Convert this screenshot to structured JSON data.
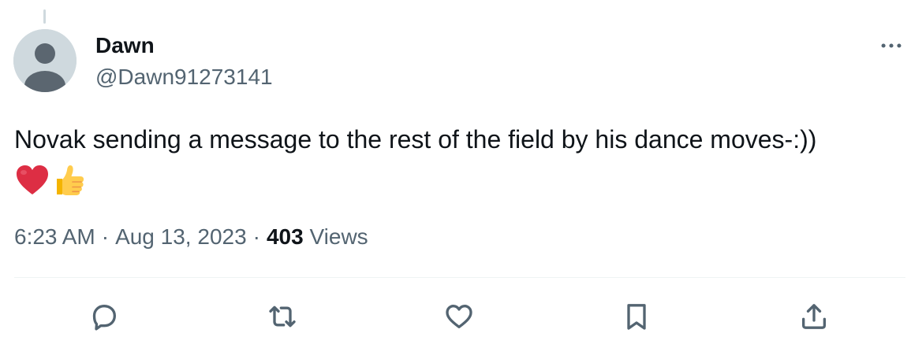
{
  "author": {
    "display_name": "Dawn",
    "handle": "@Dawn91273141",
    "avatar_icon": "default-profile-icon"
  },
  "tweet": {
    "text": "Novak sending a message to the rest of the field by his dance moves-:))",
    "emojis": [
      "red-heart-emoji",
      "thumbs-up-emoji"
    ],
    "time": "6:23 AM",
    "separator": "·",
    "date": "Aug 13, 2023",
    "views_count": "403",
    "views_label": "Views"
  },
  "icons": {
    "more": "more-horizontal-icon",
    "reply": "reply-icon",
    "retweet": "retweet-icon",
    "like": "like-icon",
    "bookmark": "bookmark-icon",
    "share": "share-icon"
  },
  "colors": {
    "text_primary": "#0f1419",
    "text_secondary": "#536471",
    "divider": "#eff3f4",
    "avatar_bg": "#cfd9de",
    "avatar_figure": "#71767b",
    "heart": "#dd2e44",
    "thumbs_up": "#ffcc4d"
  }
}
